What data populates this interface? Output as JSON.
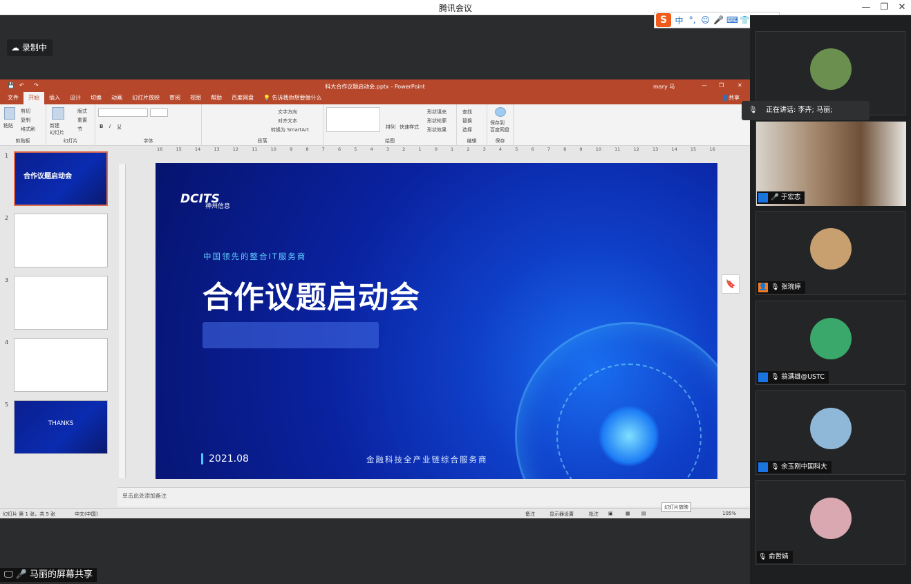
{
  "window": {
    "title": "腾讯会议"
  },
  "recording": {
    "label": "录制中"
  },
  "ime": {
    "logo": "S",
    "icons": [
      "中",
      "°,",
      "☺",
      "🎤",
      "⌨",
      "👕",
      "▦"
    ]
  },
  "ppt": {
    "window_title": "科大合作议题启动会.pptx - PowerPoint",
    "user": "mary 马",
    "share_label": "共享",
    "tabs": [
      "文件",
      "开始",
      "插入",
      "设计",
      "切换",
      "动画",
      "幻灯片放映",
      "审阅",
      "视图",
      "帮助",
      "百度网盘"
    ],
    "tellme": "告诉我你想要做什么",
    "groups": {
      "clipboard": {
        "label": "剪贴板",
        "paste": "粘贴",
        "cut": "剪切",
        "copy": "复制",
        "format": "格式刷"
      },
      "slides": {
        "label": "幻灯片",
        "new": "新建\n幻灯片",
        "layout": "版式",
        "reset": "重置",
        "section": "节"
      },
      "font": {
        "label": "字体"
      },
      "paragraph": {
        "label": "段落",
        "text_dir": "文字方向",
        "align": "对齐文本",
        "smartart": "转换为 SmartArt"
      },
      "drawing": {
        "label": "绘图",
        "arrange": "排列",
        "quick": "快速样式",
        "fill": "形状填充",
        "outline": "形状轮廓",
        "effect": "形状效果"
      },
      "editing": {
        "label": "编辑",
        "find": "查找",
        "replace": "替换",
        "select": "选择"
      },
      "save": {
        "label": "保存",
        "save_baidu": "保存到\n百度网盘"
      }
    },
    "ruler_ticks": [
      "16",
      "15",
      "14",
      "13",
      "12",
      "11",
      "10",
      "9",
      "8",
      "7",
      "6",
      "5",
      "4",
      "3",
      "2",
      "1",
      "0",
      "1",
      "2",
      "3",
      "4",
      "5",
      "6",
      "7",
      "8",
      "9",
      "10",
      "11",
      "12",
      "13",
      "14",
      "15",
      "16"
    ],
    "thumbnails": [
      {
        "num": "1",
        "title": "合作议题启动会"
      },
      {
        "num": "2"
      },
      {
        "num": "3"
      },
      {
        "num": "4"
      },
      {
        "num": "5",
        "title": "THANKS"
      }
    ],
    "slide": {
      "logo": "DCITS",
      "logo_cn": "神州信息",
      "subtitle": "中国领先的整合IT服务商",
      "title": "合作议题启动会",
      "date": "2021.08",
      "tagline": "金融科技全产业链综合服务商"
    },
    "notes_placeholder": "单击此处添加备注",
    "status": {
      "slide_info": "幻灯片 第 1 张，共 5 张",
      "lang": "中文(中国)",
      "notes": "备注",
      "display": "显示器设置",
      "comments": "批注",
      "tooltip": "幻灯片放映",
      "zoom": "105%"
    }
  },
  "share_banner": "马丽的屏幕共享",
  "speaking": "正在讲话: 李卉; 马丽;",
  "participants": [
    {
      "name": "",
      "avatar_color": "#6a8f4e"
    },
    {
      "name": "于宏志",
      "avatar_color": "#8a6a4d",
      "video": true
    },
    {
      "name": "张琬婷",
      "avatar_color": "#c8a070"
    },
    {
      "name": "翁满雄@USTC",
      "avatar_color": "#3aa86a"
    },
    {
      "name": "余玉刚中国科大",
      "avatar_color": "#8fb7d8"
    },
    {
      "name": "俞哲婧",
      "avatar_color": "#d9a8b0"
    }
  ]
}
